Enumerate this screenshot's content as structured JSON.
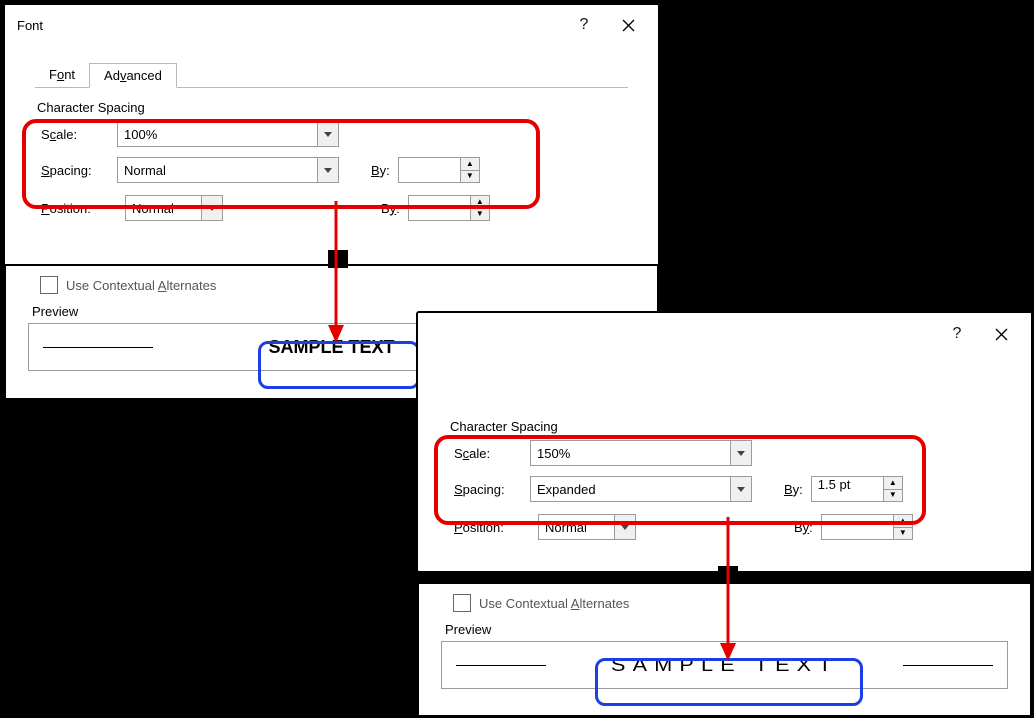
{
  "dialog1": {
    "title": "Font",
    "help": "?",
    "tabs": {
      "font": "Font",
      "advanced": "Advanced"
    },
    "section": "Character Spacing",
    "labels": {
      "scale": "Scale:",
      "spacing": "Spacing:",
      "position": "Position:",
      "by": "By:"
    },
    "ul": {
      "scale_letter": "c",
      "spacing_letter": "S",
      "position_letter": "P",
      "by_letter": "B"
    },
    "values": {
      "scale": "100%",
      "spacing": "Normal",
      "position": "Normal",
      "by_spacing": "",
      "by_position": ""
    },
    "alternates": {
      "label_pre": "Use Contextual ",
      "label_ul": "A",
      "label_post": "lternates"
    },
    "preview": {
      "label": "Preview",
      "sample": "SAMPLE TEXT"
    }
  },
  "dialog2": {
    "help": "?",
    "section": "Character Spacing",
    "labels": {
      "scale": "Scale:",
      "spacing": "Spacing:",
      "position": "Position:",
      "by": "By:"
    },
    "ul": {
      "scale_letter": "c",
      "spacing_letter": "S",
      "position_letter": "P",
      "by_letter": "B"
    },
    "values": {
      "scale": "150%",
      "spacing": "Expanded",
      "position": "Normal",
      "by_spacing": "1.5 pt",
      "by_position": ""
    },
    "alternates": {
      "label_pre": "Use Contextual ",
      "label_ul": "A",
      "label_post": "lternates"
    },
    "preview": {
      "label": "Preview",
      "sample": "SAMPLE TEXT"
    }
  }
}
